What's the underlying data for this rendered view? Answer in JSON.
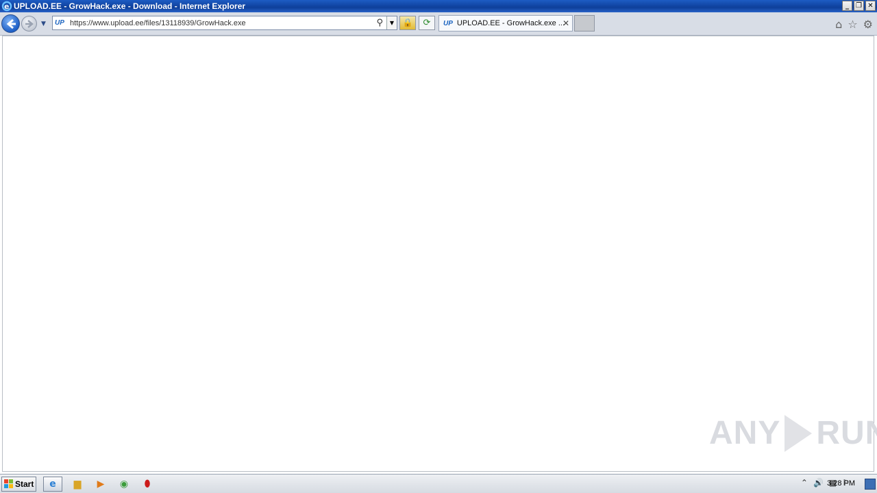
{
  "window": {
    "title": "UPLOAD.EE - GrowHack.exe - Download - Internet Explorer",
    "controls": [
      "_",
      "❐",
      "✕"
    ]
  },
  "nav": {
    "address_favicon": "UP",
    "url": "https://www.upload.ee/files/13118939/GrowHack.exe"
  },
  "tabs": [
    {
      "favicon": "UP",
      "label": "UPLOAD.EE - GrowHack.exe ..."
    }
  ],
  "toolbar_icons": [
    "home-icon",
    "favorites-star-icon",
    "settings-gear-icon"
  ],
  "watermark": {
    "left": "ANY",
    "right": "RUN"
  },
  "taskbar": {
    "start_label": "Start",
    "apps": [
      "internet-explorer-icon",
      "file-explorer-icon",
      "media-player-icon",
      "chrome-icon",
      "opera-icon"
    ],
    "clock": "3:28 PM"
  },
  "colors": {
    "titlebar": "#1d5cc4",
    "accent": "#1b64c0"
  }
}
